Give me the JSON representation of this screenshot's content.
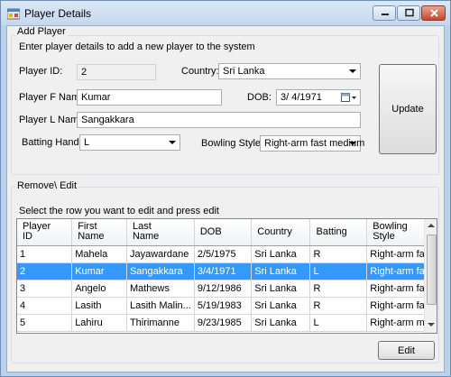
{
  "window": {
    "title": "Player Details"
  },
  "add_player": {
    "group_title": "Add Player",
    "instruction": "Enter player details to add a new player to the system",
    "player_id_label": "Player ID:",
    "player_id_value": "2",
    "country_label": "Country:",
    "country_value": "Sri Lanka",
    "first_name_label": "Player F Name:",
    "first_name_value": "Kumar",
    "dob_label": "DOB:",
    "dob_value": "3/  4/1971",
    "last_name_label": "Player L Name:",
    "last_name_value": "Sangakkara",
    "batting_hand_label": "Batting Hand:",
    "batting_hand_value": "L",
    "bowling_style_label": "Bowling Style :",
    "bowling_style_value": "Right-arm fast medium",
    "update_label": "Update"
  },
  "remove_edit": {
    "group_title": "Remove\\ Edit",
    "instruction": "Select the row you want to edit and press edit",
    "columns": [
      [
        "Player",
        "ID"
      ],
      [
        "First",
        "Name"
      ],
      [
        "Last",
        "Name"
      ],
      [
        "DOB",
        ""
      ],
      [
        "Country",
        ""
      ],
      [
        "Batting",
        ""
      ],
      [
        "Bowling",
        "Style"
      ]
    ],
    "rows": [
      [
        "1",
        "Mahela",
        "Jayawardane",
        "2/5/1975",
        "Sri Lanka",
        "R",
        "Right-arm fast"
      ],
      [
        "2",
        "Kumar",
        "Sangakkara",
        "3/4/1971",
        "Sri Lanka",
        "L",
        "Right-arm fa..."
      ],
      [
        "3",
        "Angelo",
        "Mathews",
        "9/12/1986",
        "Sri Lanka",
        "R",
        "Right-arm fast"
      ],
      [
        "4",
        "Lasith",
        "Lasith Malin...",
        "5/19/1983",
        "Sri Lanka",
        "R",
        "Right-arm fast"
      ],
      [
        "5",
        "Lahiru",
        "Thirimanne",
        "9/23/1985",
        "Sri Lanka",
        "L",
        "Right-arm m..."
      ]
    ],
    "selected_row": 1,
    "edit_label": "Edit"
  }
}
